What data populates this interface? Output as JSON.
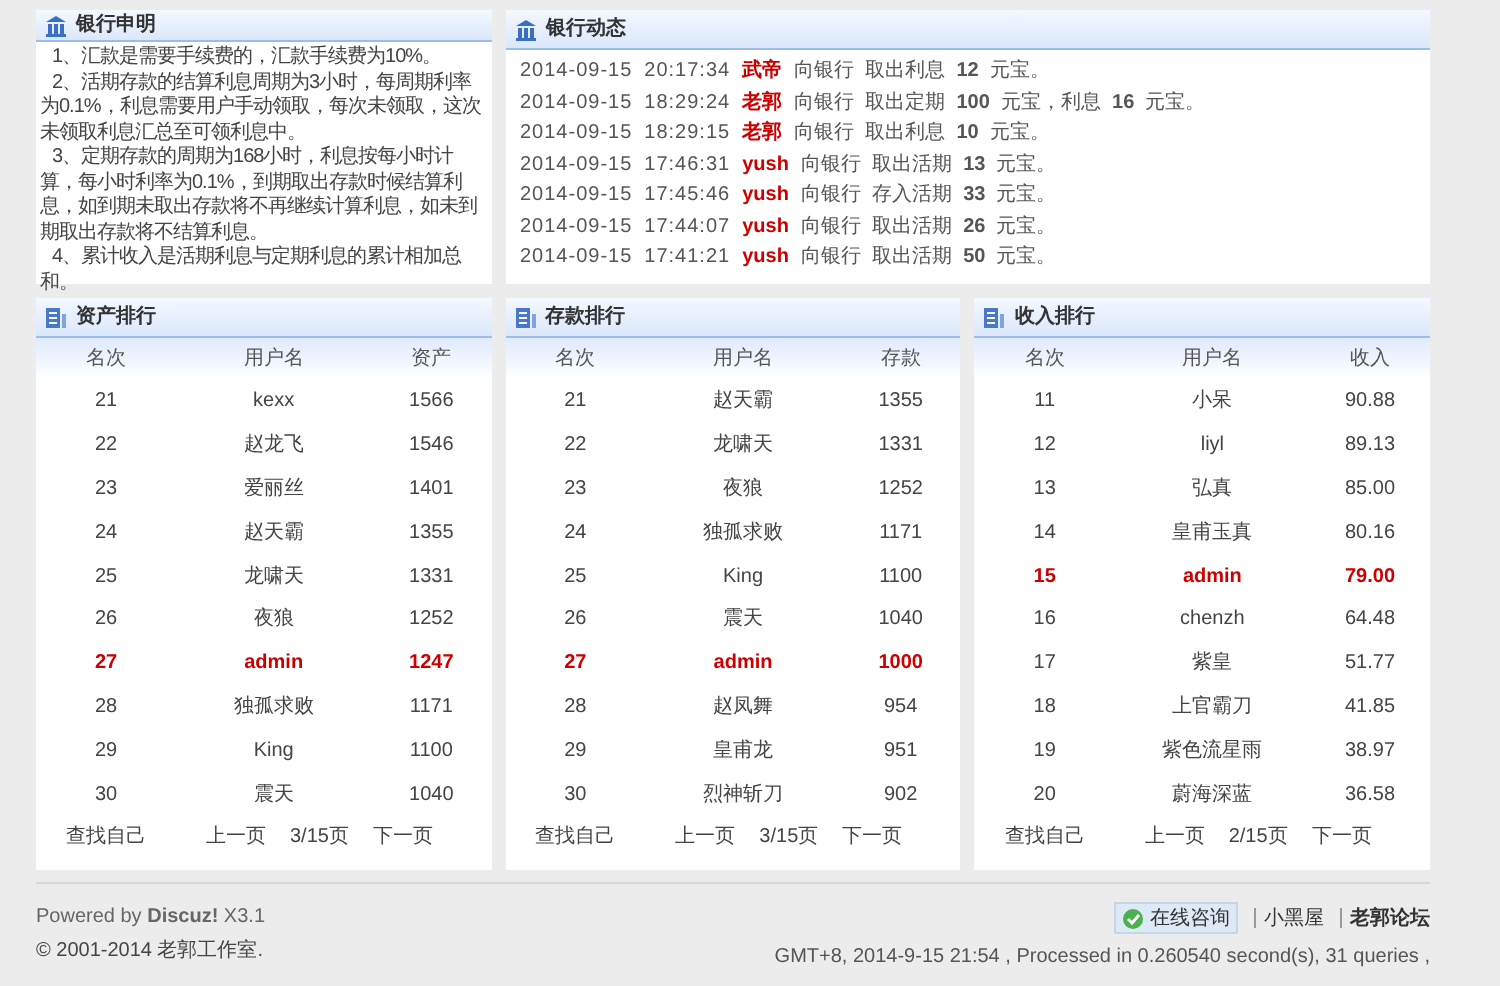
{
  "notice": {
    "title": "银行申明",
    "items": [
      "1、汇款是需要手续费的，汇款手续费为10%。",
      "2、活期存款的结算利息周期为3小时，每周期利率为0.1%，利息需要用户手动领取，每次未领取，这次未领取利息汇总至可领利息中。",
      "3、定期存款的周期为168小时，利息按每小时计算，每小时利率为0.1%，到期取出存款时候结算利息，如到期未取出存款将不再继续计算利息，如未到期取出存款将不结算利息。",
      "4、累计收入是活期利息与定期利息的累计相加总和。"
    ]
  },
  "activity": {
    "title": "银行动态",
    "entries": [
      {
        "date": "2014-09-15",
        "time": "20:17:34",
        "user": "武帝",
        "text": "向银行  取出利息  **12**  元宝。"
      },
      {
        "date": "2014-09-15",
        "time": "18:29:24",
        "user": "老郭",
        "text": "向银行  取出定期  **100**  元宝，利息  **16**  元宝。"
      },
      {
        "date": "2014-09-15",
        "time": "18:29:15",
        "user": "老郭",
        "text": "向银行  取出利息  **10**  元宝。"
      },
      {
        "date": "2014-09-15",
        "time": "17:46:31",
        "user": "yush",
        "text": "向银行  取出活期  **13**  元宝。"
      },
      {
        "date": "2014-09-15",
        "time": "17:45:46",
        "user": "yush",
        "text": "向银行  存入活期  **33**  元宝。"
      },
      {
        "date": "2014-09-15",
        "time": "17:44:07",
        "user": "yush",
        "text": "向银行  取出活期  **26**  元宝。"
      },
      {
        "date": "2014-09-15",
        "time": "17:41:21",
        "user": "yush",
        "text": "向银行  取出活期  **50**  元宝。"
      }
    ]
  },
  "rankings": [
    {
      "title": "资产排行",
      "columns": [
        "名次",
        "用户名",
        "资产"
      ],
      "rows": [
        [
          "21",
          "kexx",
          "1566",
          false
        ],
        [
          "22",
          "赵龙飞",
          "1546",
          false
        ],
        [
          "23",
          "爱丽丝",
          "1401",
          false
        ],
        [
          "24",
          "赵天霸",
          "1355",
          false
        ],
        [
          "25",
          "龙啸天",
          "1331",
          false
        ],
        [
          "26",
          "夜狼",
          "1252",
          false
        ],
        [
          "27",
          "admin",
          "1247",
          true
        ],
        [
          "28",
          "独孤求败",
          "1171",
          false
        ],
        [
          "29",
          "King",
          "1100",
          false
        ],
        [
          "30",
          "震天",
          "1040",
          false
        ]
      ],
      "find_self": "查找自己",
      "prev": "上一页",
      "page": "3/15页",
      "next": "下一页"
    },
    {
      "title": "存款排行",
      "columns": [
        "名次",
        "用户名",
        "存款"
      ],
      "rows": [
        [
          "21",
          "赵天霸",
          "1355",
          false
        ],
        [
          "22",
          "龙啸天",
          "1331",
          false
        ],
        [
          "23",
          "夜狼",
          "1252",
          false
        ],
        [
          "24",
          "独孤求败",
          "1171",
          false
        ],
        [
          "25",
          "King",
          "1100",
          false
        ],
        [
          "26",
          "震天",
          "1040",
          false
        ],
        [
          "27",
          "admin",
          "1000",
          true
        ],
        [
          "28",
          "赵凤舞",
          "954",
          false
        ],
        [
          "29",
          "皇甫龙",
          "951",
          false
        ],
        [
          "30",
          "烈神斩刀",
          "902",
          false
        ]
      ],
      "find_self": "查找自己",
      "prev": "上一页",
      "page": "3/15页",
      "next": "下一页"
    },
    {
      "title": "收入排行",
      "columns": [
        "名次",
        "用户名",
        "收入"
      ],
      "rows": [
        [
          "11",
          "小呆",
          "90.88",
          false
        ],
        [
          "12",
          "liyl",
          "89.13",
          false
        ],
        [
          "13",
          "弘真",
          "85.00",
          false
        ],
        [
          "14",
          "皇甫玉真",
          "80.16",
          false
        ],
        [
          "15",
          "admin",
          "79.00",
          true
        ],
        [
          "16",
          "chenzh",
          "64.48",
          false
        ],
        [
          "17",
          "紫皇",
          "51.77",
          false
        ],
        [
          "18",
          "上官霸刀",
          "41.85",
          false
        ],
        [
          "19",
          "紫色流星雨",
          "38.97",
          false
        ],
        [
          "20",
          "蔚海深蓝",
          "36.58",
          false
        ]
      ],
      "find_self": "查找自己",
      "prev": "上一页",
      "page": "2/15页",
      "next": "下一页"
    }
  ],
  "footer": {
    "powered": "Powered by **Discuz!** X3.1",
    "copyright": "© 2001-2014 老郭工作室.",
    "consult": "在线咨询",
    "links": [
      "小黑屋",
      "老郭论坛"
    ],
    "stats": "GMT+8, 2014-9-15 21:54 , Processed in 0.260540 second(s), 31 queries ,"
  }
}
